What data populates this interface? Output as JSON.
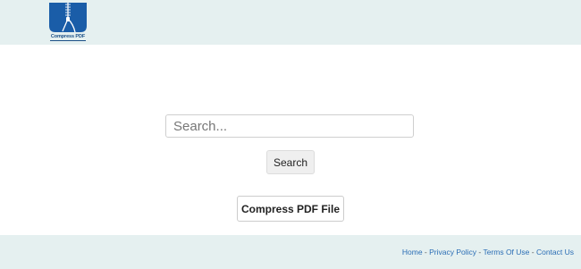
{
  "header": {
    "logo_text": "Compress PDF",
    "logo_icon": "zipper-document-icon",
    "brand_color": "#1a5da8"
  },
  "search": {
    "placeholder": "Search...",
    "value": "",
    "button_label": "Search"
  },
  "main": {
    "compress_button_label": "Compress PDF File"
  },
  "footer": {
    "links": [
      "Home",
      "Privacy Policy",
      "Terms Of Use",
      "Contact Us"
    ],
    "separator": " - "
  },
  "colors": {
    "header_bg": "#e5f0f0",
    "footer_bg": "#e5f0f0",
    "link": "#2a6db5"
  }
}
